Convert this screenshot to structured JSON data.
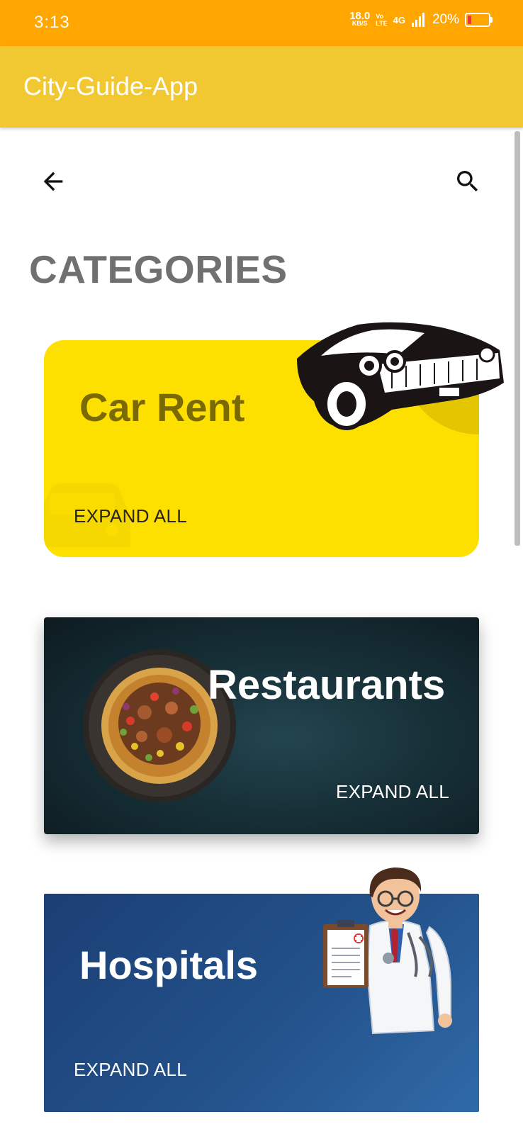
{
  "status_bar": {
    "time": "3:13",
    "net_speed_value": "18.0",
    "net_speed_unit": "KB/S",
    "volte_top": "Vo",
    "volte_bottom": "LTE",
    "network_type": "4G",
    "battery_percent": "20%",
    "battery_level": 0.2,
    "battery_color": "#E53935"
  },
  "app_bar": {
    "title": "City-Guide-App",
    "color": "#F2C832"
  },
  "toolbar": {
    "back_icon": "arrow-left-icon",
    "search_icon": "search-icon"
  },
  "page": {
    "title": "CATEGORIES"
  },
  "categories": [
    {
      "title": "Car Rent",
      "action": "EXPAND ALL",
      "background": "#FEE000",
      "illustration": "vintage-car-illustration"
    },
    {
      "title": "Restaurants",
      "action": "EXPAND ALL",
      "background": "#173038",
      "illustration": "pizza-plate-illustration"
    },
    {
      "title": "Hospitals",
      "action": "EXPAND ALL",
      "background": "#23518a",
      "illustration": "doctor-illustration"
    }
  ]
}
